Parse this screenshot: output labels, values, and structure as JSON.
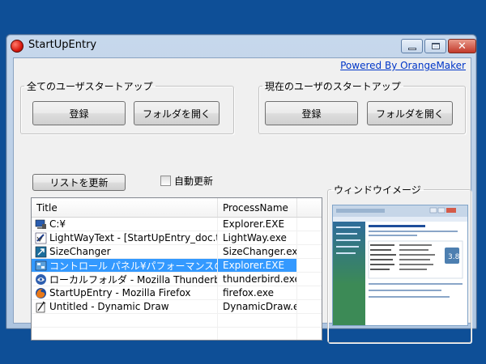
{
  "window": {
    "title": "StartUpEntry",
    "min_label": "minimize",
    "close_glyph": "✕"
  },
  "powered_link": "Powered By OrangeMaker",
  "all_users_group": {
    "legend": "全てのユーザスタートアップ",
    "register_label": "登録",
    "open_folder_label": "フォルダを開く"
  },
  "current_user_group": {
    "legend": "現在のユーザのスタートアップ",
    "register_label": "登録",
    "open_folder_label": "フォルダを開く"
  },
  "refresh_button_label": "リストを更新",
  "auto_update_label": "自動更新",
  "auto_update_checked": false,
  "list": {
    "columns": [
      "Title",
      "ProcessName"
    ],
    "rows": [
      {
        "icon": "computer-icon",
        "title": "C:¥",
        "process": "Explorer.EXE",
        "selected": false
      },
      {
        "icon": "lightway-icon",
        "title": "LightWayText - [StartUpEntry_doc.txt]",
        "process": "LightWay.exe",
        "selected": false
      },
      {
        "icon": "sizechanger-icon",
        "title": "SizeChanger",
        "process": "SizeChanger.exe",
        "selected": false
      },
      {
        "icon": "control-panel-icon",
        "title": "コントロール パネル¥パフォーマンスの情報...",
        "process": "Explorer.EXE",
        "selected": true
      },
      {
        "icon": "thunderbird-icon",
        "title": "ローカルフォルダ - Mozilla Thunderbird",
        "process": "thunderbird.exe",
        "selected": false
      },
      {
        "icon": "firefox-icon",
        "title": "StartUpEntry - Mozilla Firefox",
        "process": "firefox.exe",
        "selected": false
      },
      {
        "icon": "dynamicdraw-icon",
        "title": "Untitled - Dynamic Draw",
        "process": "DynamicDraw.exe",
        "selected": false
      }
    ]
  },
  "preview_group": {
    "legend": "ウィンドウイメージ"
  }
}
